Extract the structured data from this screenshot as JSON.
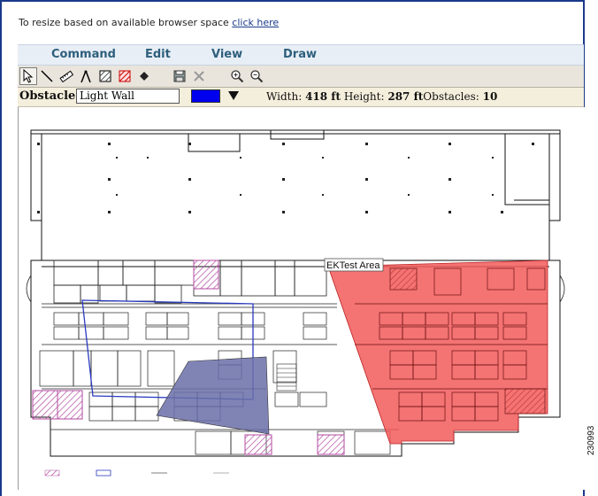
{
  "header": {
    "resize_text": "To resize based on available browser space",
    "resize_link": "click here"
  },
  "menu": {
    "items": [
      {
        "label": "Command"
      },
      {
        "label": "Edit"
      },
      {
        "label": "View"
      },
      {
        "label": "Draw"
      }
    ]
  },
  "toolbar": {
    "tools": [
      {
        "icon": "select-arrow-icon",
        "active": true
      },
      {
        "icon": "line-icon"
      },
      {
        "icon": "ruler-icon"
      },
      {
        "icon": "compass-icon"
      },
      {
        "icon": "hatch-fill-icon"
      },
      {
        "icon": "hatch-fill-red-icon"
      },
      {
        "icon": "point-icon"
      },
      {
        "icon": "save-icon"
      },
      {
        "icon": "delete-icon"
      },
      {
        "icon": "zoom-in-icon"
      },
      {
        "icon": "zoom-out-icon"
      }
    ]
  },
  "properties": {
    "obstacle_label": "Obstacle",
    "obstacle_type": "Light Wall",
    "swatch_color": "#0000ee",
    "width_label": "Width:",
    "width_value": "418 ft",
    "height_label": "Height:",
    "height_value": "287 ft",
    "obstacles_label": "Obstacles:",
    "obstacles_value": "10"
  },
  "map": {
    "test_area_label": "EKTest Area",
    "test_area_color": "#f25a5a",
    "coverage_color": "#6a6fa8",
    "legend": [
      "",
      "",
      "",
      ""
    ]
  },
  "figure_id": "230993"
}
